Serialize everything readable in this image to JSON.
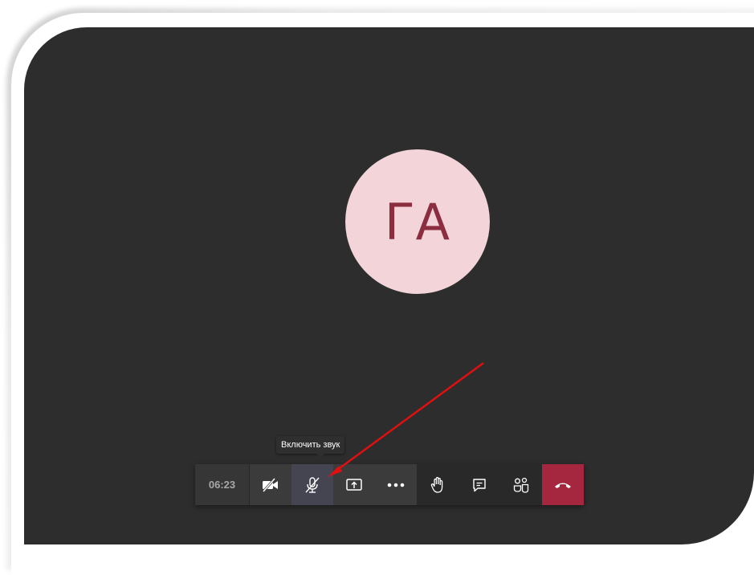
{
  "avatar": {
    "initials": "ГА"
  },
  "tooltip": {
    "text": "Включить звук"
  },
  "toolbar": {
    "timer": "06:23",
    "buttons": [
      {
        "icon": "camera-off-icon"
      },
      {
        "icon": "mic-off-icon",
        "state": "muted"
      },
      {
        "icon": "share-screen-icon"
      },
      {
        "icon": "more-icon"
      },
      {
        "icon": "raise-hand-icon"
      },
      {
        "icon": "chat-icon"
      },
      {
        "icon": "participants-icon"
      },
      {
        "icon": "hang-up-icon"
      }
    ]
  },
  "colors": {
    "stage": "#2d2d2d",
    "avatar_bg": "#f2d4d9",
    "avatar_text": "#8b2f40",
    "hangup": "#a4273f",
    "annotation_arrow": "#e01010"
  }
}
